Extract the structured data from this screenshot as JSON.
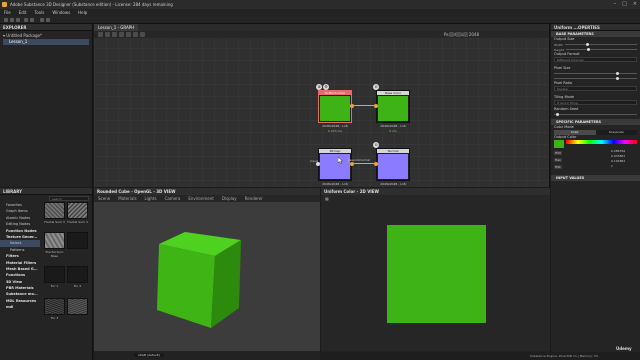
{
  "app": {
    "title": "Adobe Substance 3D Designer (Substance edition) - License: 284 days remaining"
  },
  "menu": [
    "File",
    "Edit",
    "Tools",
    "Windows",
    "Help"
  ],
  "explorer": {
    "title": "EXPLORER",
    "package": "Untitled Package*",
    "graph": "Lesson_1"
  },
  "graph": {
    "tab": "Lesson_1 - GRAPH",
    "parent_size_label": "Parent Size:",
    "parent_size_value": "2048",
    "nodes": [
      {
        "title": "Uniform Color",
        "sub": "2048x2048 - L16",
        "label": "0.213 ms",
        "color": "#3db316",
        "selected": true
      },
      {
        "title": "Base Color",
        "sub": "2048x2048 - L16",
        "label": "0 ms",
        "color": "#3db316",
        "selected": false
      },
      {
        "title": "Bitmap",
        "sub": "2048x2048 - L16",
        "label": "",
        "color": "#8b7cff",
        "selected": false
      },
      {
        "title": "Normal",
        "sub": "2048x2048 - L16",
        "label": "",
        "color": "#8b7cff",
        "selected": false
      }
    ],
    "port_labels": {
      "output": "Output",
      "input": "Input",
      "node_input": "Input",
      "normal_port": "basecolor/normal"
    }
  },
  "properties": {
    "title": "Uniform ...OPERTIES",
    "base_parameters": "BASE PARAMETERS",
    "output_size": "Output Size",
    "width": "Width",
    "height": "Height",
    "output_format": "Output Format",
    "output_format_value": "Different Channel",
    "pixel_size": "Pixel Size",
    "pixel_ratio": "Pixel Ratio",
    "pixel_ratio_value": "Square",
    "tiling_mode": "Tiling Mode",
    "tiling_value": "H and V Tiling",
    "random_seed": "Random Seed",
    "specific_parameters": "SPECIFIC PARAMETERS",
    "color_mode": "Color Mode",
    "color_mode_color": "Color",
    "color_mode_gray": "Grayscale",
    "output_color": "Output Color",
    "color_values": [
      "0.286762",
      "0.933667",
      "0.194861",
      "1"
    ],
    "color_modes": [
      "HSV",
      "Hex",
      "HSL",
      "HSV"
    ],
    "input_values": "INPUT VALUES",
    "accent": "#3db316"
  },
  "library": {
    "title": "LIBRARY",
    "search": "search",
    "nav": [
      "Favorites",
      "Graph Items",
      "Atomic Nodes",
      "Editing Nodes",
      "Function Nodes",
      "Texture Gener...",
      "Noises",
      "Patterns",
      "Filters",
      "Material Filters",
      "Mesh Based G...",
      "Functions",
      "3D View",
      "PBR Materials",
      "Substance mo...",
      "MDL Resources",
      "mdl"
    ],
    "thumbs": [
      "Fractal Sum 3",
      "Fractal Sum 4",
      "Fractal Sum Base",
      "Fur 1",
      "Fur 2",
      "Fur 3"
    ]
  },
  "view3d": {
    "title": "Rounded Cube - OpenGL - 3D VIEW",
    "menu": [
      "Scene",
      "Materials",
      "Lights",
      "Camera",
      "Environment",
      "Display",
      "Renderer"
    ],
    "footer": "sRGB (default)"
  },
  "view2d": {
    "title": "Uniform Color - 2D VIEW",
    "zoom": "15.06%"
  },
  "status": {
    "engine": "Substance Engine: Direct3D 11",
    "memory": "Memory: 3%"
  },
  "watermark": "Udemy"
}
